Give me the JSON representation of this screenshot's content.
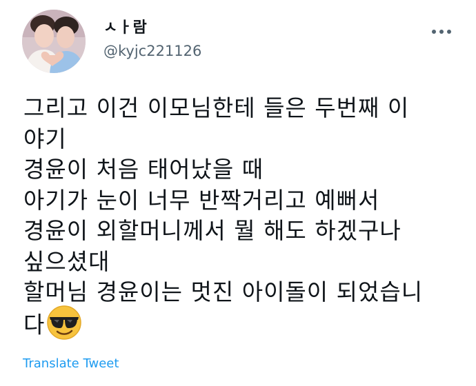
{
  "author": {
    "display_name": "ㅅㅏ람",
    "handle": "@kyjc221126",
    "avatar_icon": "profile-photo"
  },
  "menu": {
    "more_icon": "ellipsis-icon"
  },
  "tweet": {
    "lines": [
      "그리고 이건 이모님한테 들은 두번째 이",
      "야기",
      "경윤이 처음 태어났을 때",
      "아기가 눈이 너무 반짝거리고 예뻐서",
      "경윤이 외할머니께서 뭘 해도 하겠구나",
      "싶으셨대",
      "할머님 경윤이는 멋진 아이돌이 되었습니",
      "다"
    ],
    "emoji": "smiling-face-with-sunglasses"
  },
  "actions": {
    "translate_label": "Translate Tweet"
  },
  "colors": {
    "text": "#0f1419",
    "secondary": "#536471",
    "link": "#1d9bf0",
    "emoji_yellow": "#f7c33d"
  }
}
